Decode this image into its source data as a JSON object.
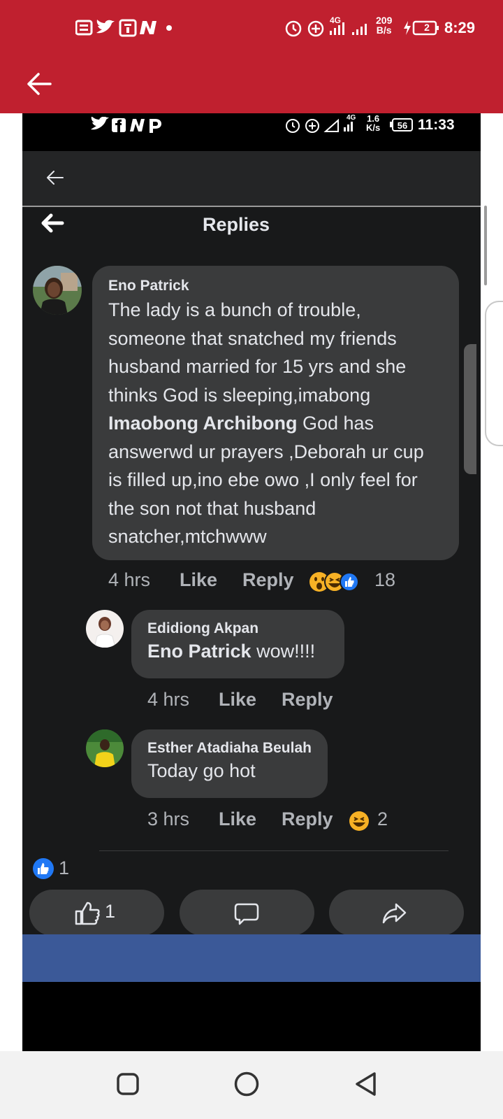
{
  "outer_status": {
    "network_type": "4G",
    "speed_value": "209",
    "speed_unit": "B/s",
    "battery": "2",
    "time": "8:29"
  },
  "inner_status": {
    "network_type": "4G",
    "speed_value": "1.6",
    "speed_unit": "K/s",
    "battery": "56",
    "time": "11:33"
  },
  "header": {
    "title": "Replies"
  },
  "comments": [
    {
      "author": "Eno Patrick",
      "text_before": "The lady is a bunch of trouble, someone that snatched my friends husband married for 15 yrs and she thinks God is sleeping,imabong ",
      "mention": "Imaobong Archibong",
      "text_after": " God has answerwd ur prayers ,Deborah ur cup is filled up,ino ebe owo ,I only feel for the son not that husband snatcher,mtchwww",
      "time": "4 hrs",
      "like_label": "Like",
      "reply_label": "Reply",
      "reaction_count": "18",
      "reactions": [
        "wow",
        "haha",
        "like"
      ]
    },
    {
      "author": "Edidiong Akpan",
      "mention": "Eno Patrick",
      "text_after": " wow!!!!",
      "time": "4 hrs",
      "like_label": "Like",
      "reply_label": "Reply"
    },
    {
      "author": "Esther Atadiaha Beulah",
      "text_after": "Today go hot",
      "time": "3 hrs",
      "like_label": "Like",
      "reply_label": "Reply",
      "reaction_count": "2",
      "reactions": [
        "haha"
      ]
    }
  ],
  "post_reactions": {
    "count": "1"
  },
  "actions": {
    "like_count": "1"
  },
  "colors": {
    "outer_header": "#c0202f",
    "bubble": "#3a3b3c",
    "background": "#18191a",
    "facebook_blue": "#3b5998",
    "like_blue": "#2078f4"
  }
}
